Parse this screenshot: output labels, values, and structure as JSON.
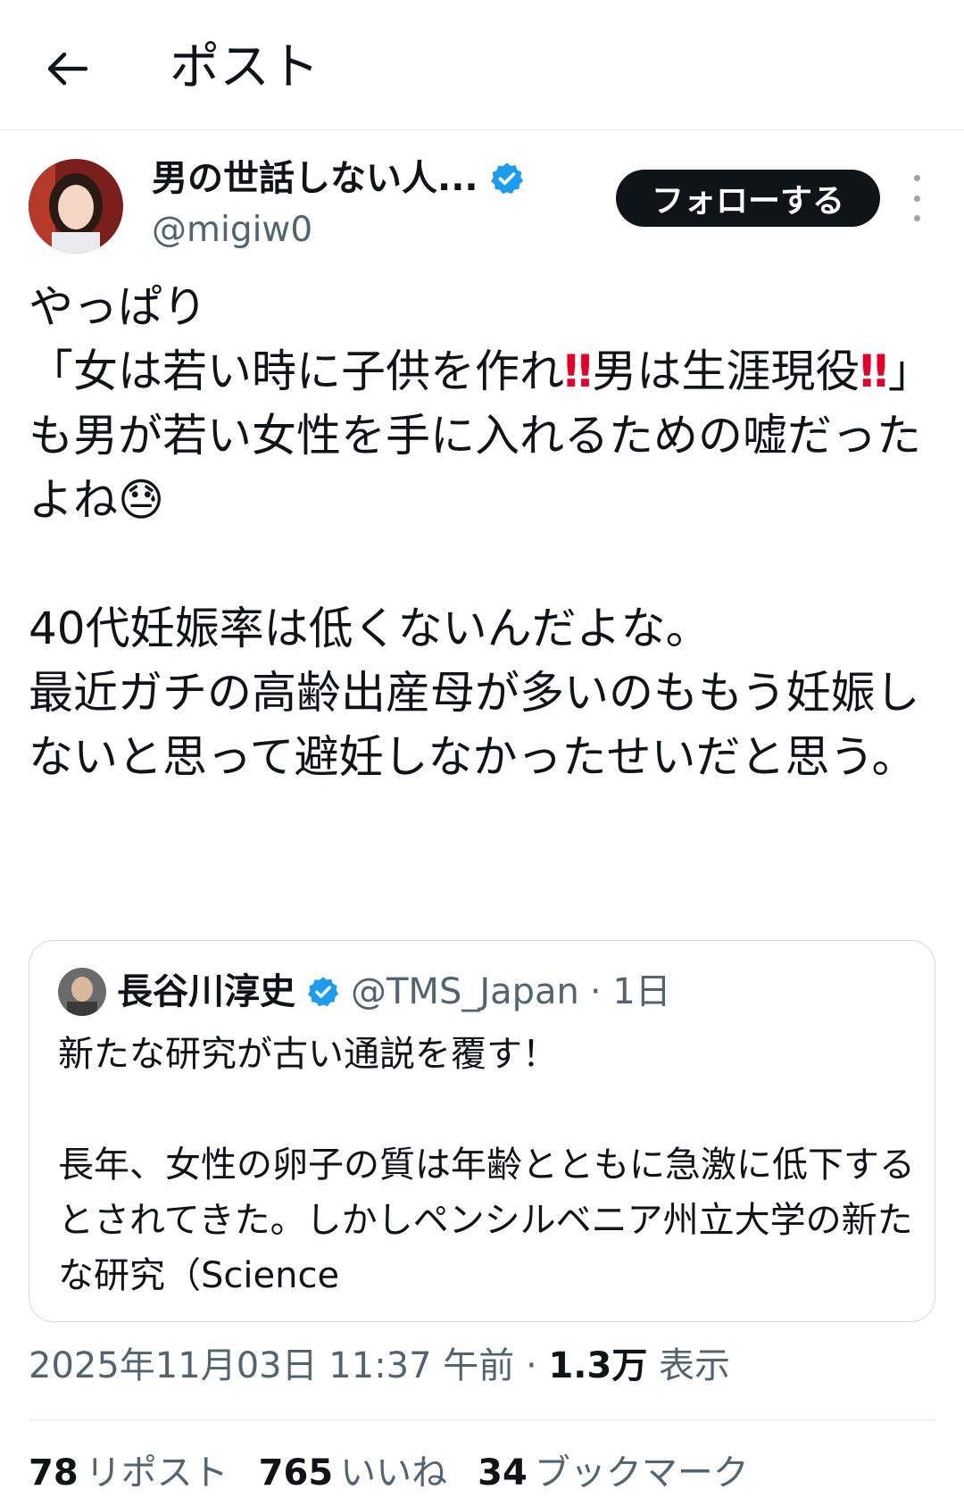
{
  "header": {
    "title": "ポスト",
    "back_icon": "arrow-left-icon"
  },
  "author": {
    "name": "男の世話しない人...",
    "handle": "@migiw0",
    "verified_color": "#1d9bf0",
    "follow_label": "フォローする"
  },
  "tweet": {
    "seg1": "やっぱり\n「女は若い時に子供を作れ",
    "bang1": "‼",
    "seg2": "男は生涯現役",
    "bang2": "‼",
    "seg3": "」\nも男が若い女性を手に入れるための嘘だったよね",
    "emoji": "😓",
    "seg4": "\n\n40代妊娠率は低くないんだよな。\n最近ガチの高齢出産母が多いのももう妊娠しないと思って避妊しなかったせいだと思う。"
  },
  "quote": {
    "name": "長谷川淳史",
    "handle": "@TMS_Japan",
    "time": "· 1日",
    "text": "新たな研究が古い通説を覆す！\n\n長年、女性の卵子の質は年齢とともに急激に低下するとされてきた。しかしペンシルベニア州立大学の新たな研究（Science"
  },
  "meta": {
    "datetime": "2025年11月03日 11:37 午前",
    "sep": "·",
    "views": "1.3万",
    "views_label": "表示"
  },
  "stats": {
    "reposts": "78",
    "reposts_label": "リポスト",
    "likes": "765",
    "likes_label": "いいね",
    "bookmarks": "34",
    "bookmarks_label": "ブックマーク"
  }
}
